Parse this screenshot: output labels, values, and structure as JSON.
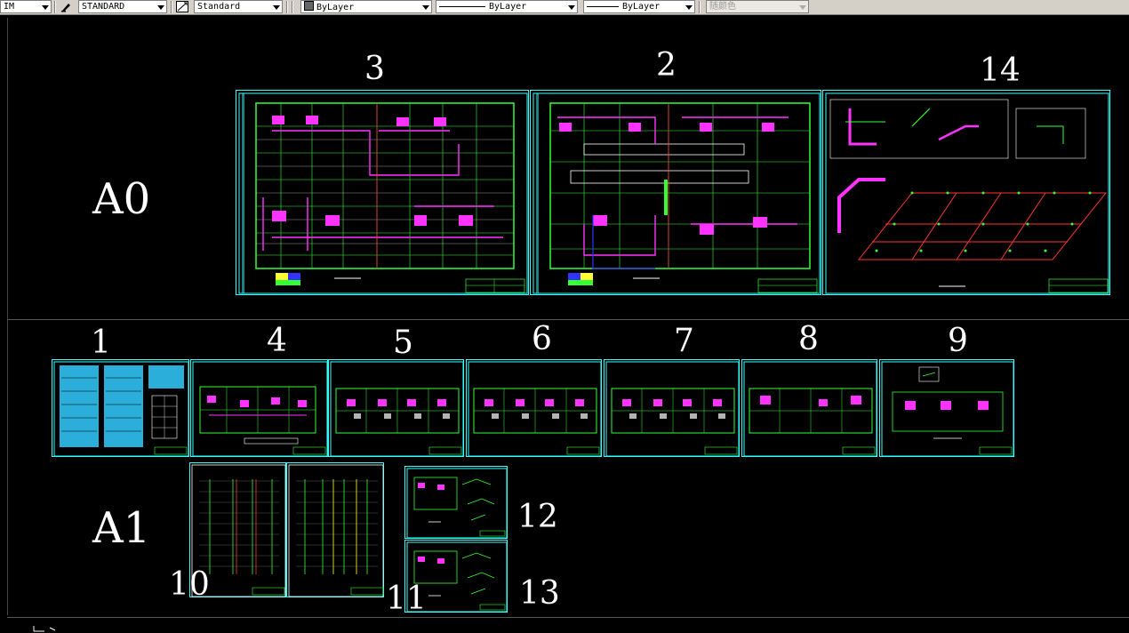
{
  "toolbar": {
    "layer_value": "IM",
    "text_style_value": "STANDARD",
    "dim_style_value": "Standard",
    "color_value": "ByLayer",
    "linetype_value": "ByLayer",
    "lineweight_value": "ByLayer",
    "plot_style_value": "随颜色"
  },
  "sections": {
    "a0_label": "A0",
    "a1_label": "A1"
  },
  "sheets": {
    "s1": "1",
    "s2": "2",
    "s3": "3",
    "s4": "4",
    "s5": "5",
    "s6": "6",
    "s7": "7",
    "s8": "8",
    "s9": "9",
    "s10": "10",
    "s11": "11",
    "s12": "12",
    "s13": "13",
    "s14": "14"
  },
  "colors": {
    "background": "#000000",
    "sheet_border": "#33ffff",
    "plan_green": "#33ff33",
    "pipe_magenta": "#ff33ff",
    "pipe_red": "#ff3333",
    "toolbar_bg": "#d4d0c8"
  }
}
